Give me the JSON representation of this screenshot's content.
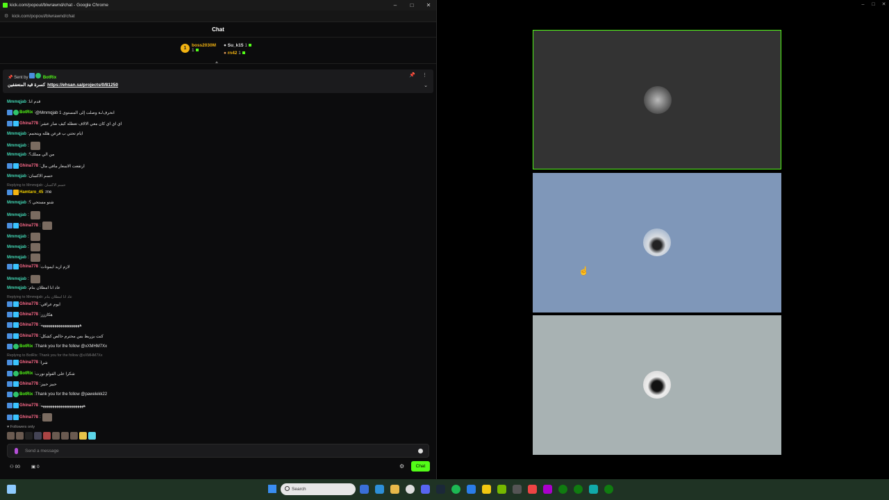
{
  "browser": {
    "title": "kick.com/popout/blwrawnd/chat - Google Chrome",
    "url": "kick.com/popout/blwrawnd/chat"
  },
  "chat": {
    "header": "Chat",
    "leaderboard": [
      {
        "name": "boss2030M",
        "count": "1"
      },
      {
        "name": "Su_k15",
        "count": "1"
      },
      {
        "name": "rn42",
        "count": "1"
      }
    ],
    "rank_badge": "1",
    "pinned": {
      "sent_by_label": "Sent by",
      "sender": "BotRix",
      "text": "كسرة قيد المتعففين",
      "link": "https://ehsan.sa/projects/0/81250"
    },
    "messages": [
      {
        "user": "Mmmqjab",
        "text": "قدم انا"
      },
      {
        "user": "BotRix",
        "text": "@Mmmqjab انحرف/ـة وصلت إلى المستوى 1"
      },
      {
        "user": "Ghina778",
        "text": "اي اي اي كان معي الالاف تعطله كيف صار عشر"
      },
      {
        "user": "Mmmqjab",
        "text": "ايام تحتي ب فرعن هلله ويتحمم"
      },
      {
        "user": "Mmmqjab",
        "text": ""
      },
      {
        "user": "Mmmqjab",
        "text": "من الي مملك؟"
      },
      {
        "user": "Ghina778",
        "text": "ارتفعت الاسعار مافي مال"
      },
      {
        "user": "Mmmqjab",
        "text": "حسم الاكسان"
      },
      {
        "user": "Hamtaro_45",
        "text": "me",
        "reply": "Replying to Mmmqjab: حسم الاكسان"
      },
      {
        "user": "Mmmqjab",
        "text": "شنو مستحي ؟"
      },
      {
        "user": "Mmmqjab",
        "text": ""
      },
      {
        "user": "Ghina778",
        "text": ""
      },
      {
        "user": "Mmmqjab",
        "text": ""
      },
      {
        "user": "Mmmqjab",
        "text": ""
      },
      {
        "user": "Mmmqjab",
        "text": ""
      },
      {
        "user": "Ghina778",
        "text": "لازم ازيد ايموتات"
      },
      {
        "user": "Mmmqjab",
        "text": ""
      },
      {
        "user": "Mmmqjab",
        "text": "عاد انا امطلان بتام"
      },
      {
        "user": "Ghina778",
        "text": "ايوم عراقي",
        "reply": "Replying to Mmmqjab: عاد انا امطلان بتام"
      },
      {
        "user": "Ghina778",
        "text": "هكاززز"
      },
      {
        "user": "Ghina778",
        "text": "ههههههههههههههههههههه"
      },
      {
        "user": "Ghina778",
        "text": "كنت بزربط بس محترم خالص كشكل"
      },
      {
        "user": "BotRix",
        "text": "Thank you for the follow @xXMHM7Xx"
      },
      {
        "user": "Ghina778",
        "text": "شرا",
        "reply": "Replying to BotRix: Thank you for the follow @xXMHM7Xx"
      },
      {
        "user": "BotRix",
        "text": "شكرا على الفولو نورت"
      },
      {
        "user": "Ghina778",
        "text": "حبيز حبيز"
      },
      {
        "user": "BotRix",
        "text": "Thank you for the follow @pawelekk22"
      },
      {
        "user": "Ghina778",
        "text": "ههههههههههههههههههههههه"
      },
      {
        "user": "Ghina778",
        "text": ""
      }
    ],
    "followers_only": "Followers only",
    "input_placeholder": "Send a message",
    "footer": {
      "viewers": "00",
      "gifts": "0",
      "chat_button": "Chat"
    }
  },
  "taskbar": {
    "search_placeholder": "Search"
  },
  "colors": {
    "kick_green": "#53fc18",
    "tile1": "#333333",
    "tile2": "#7f97b9",
    "tile3": "#a8b2b3"
  }
}
